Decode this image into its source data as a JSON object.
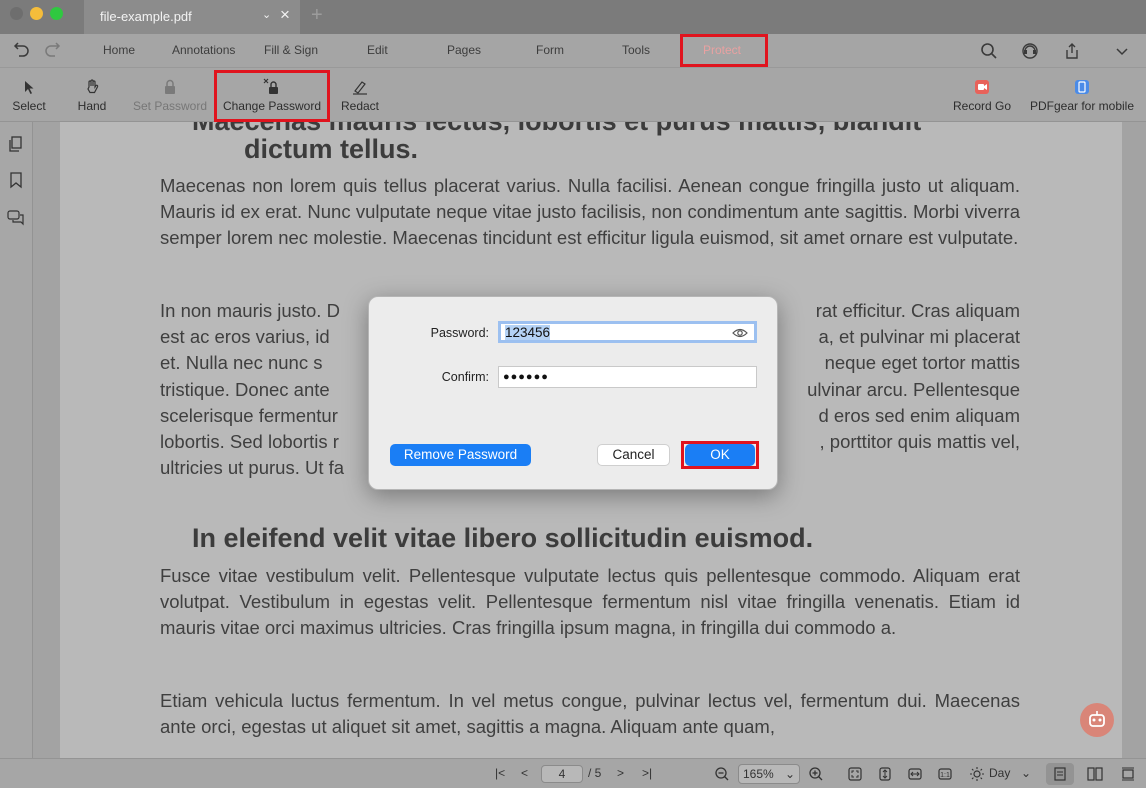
{
  "window": {
    "tab_title": "file-example.pdf",
    "new_tab": "+",
    "close_tab": "×"
  },
  "menu": {
    "items": [
      "Home",
      "Annotations",
      "Fill & Sign",
      "Edit",
      "Pages",
      "Form",
      "Tools",
      "Protect"
    ],
    "active": "Protect"
  },
  "toolbar": {
    "select": "Select",
    "hand": "Hand",
    "set_password": "Set Password",
    "change_password": "Change Password",
    "redact": "Redact",
    "record_go": "Record Go",
    "pdfgear_mobile": "PDFgear for mobile"
  },
  "document": {
    "heading_top_partial": "Maecenas mauris lectus, lobortis et purus mattis, blandit",
    "heading_top_line2": "dictum tellus.",
    "para1": "Maecenas non lorem quis tellus placerat varius. Nulla facilisi. Aenean congue fringilla justo ut aliquam. Mauris id ex erat. Nunc vulputate neque vitae justo facilisis, non condimentum ante sagittis. Morbi viverra semper lorem nec molestie. Maecenas tincidunt est efficitur ligula euismod, sit amet ornare est vulputate.",
    "para2_lines": [
      "In non mauris justo. D",
      "est ac eros varius, id",
      "et. Nulla nec nunc s",
      "tristique. Donec ante",
      "scelerisque fermentur",
      "lobortis. Sed lobortis r",
      "ultricies ut purus. Ut fa"
    ],
    "para2_right": [
      "rat efficitur. Cras aliquam",
      "a, et pulvinar mi placerat",
      "neque eget tortor mattis",
      "ulvinar arcu. Pellentesque",
      "d eros sed enim aliquam",
      ", porttitor quis mattis vel,",
      ""
    ],
    "heading2": "In eleifend velit vitae libero sollicitudin euismod.",
    "para3": "Fusce vitae vestibulum velit. Pellentesque vulputate lectus quis pellentesque commodo. Aliquam erat volutpat. Vestibulum in egestas velit. Pellentesque fermentum nisl vitae fringilla venenatis. Etiam id mauris vitae orci maximus ultricies. Cras fringilla ipsum magna, in fringilla dui commodo a.",
    "para4": "Etiam vehicula luctus fermentum. In vel metus congue, pulvinar lectus vel, fermentum dui. Maecenas ante orci, egestas ut aliquet sit amet, sagittis a magna. Aliquam ante quam,"
  },
  "dialog": {
    "password_label": "Password:",
    "password_value": "123456",
    "confirm_label": "Confirm:",
    "confirm_value": "●●●●●●",
    "remove_button": "Remove Password",
    "cancel_button": "Cancel",
    "ok_button": "OK"
  },
  "statusbar": {
    "current_page": "4",
    "page_total": "/ 5",
    "zoom": "165%",
    "theme": "Day"
  },
  "colors": {
    "accent_blue": "#1a7ef5",
    "highlight_red": "#e0141e",
    "protect_text": "#e9a1a1"
  }
}
